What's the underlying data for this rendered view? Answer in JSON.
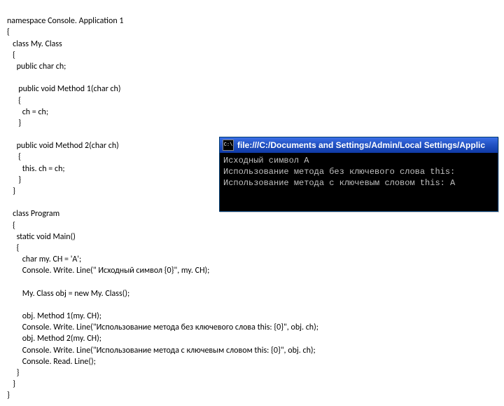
{
  "code": {
    "l01": "namespace Console. Application 1",
    "l02": "{",
    "l03": "   class My. Class",
    "l04": "   {",
    "l05": "     public char ch;",
    "l06": "",
    "l07": "      public void Method 1(char ch)",
    "l08": "      {",
    "l09": "        ch = ch;",
    "l10": "      }",
    "l11": "",
    "l12": "     public void Method 2(char ch)",
    "l13": "      {",
    "l14": "        this. ch = ch;",
    "l15": "      }",
    "l16": "   }",
    "l17": "",
    "l18": "   class Program",
    "l19": "   {",
    "l20": "     static void Main()",
    "l21": "     {",
    "l22": "        char my. CH = 'A';",
    "l23": "        Console. Write. Line(\" Исходный символ {0}\", my. CH);",
    "l24": "",
    "l25": "        My. Class obj = new My. Class();",
    "l26": "",
    "l27": "        obj. Method 1(my. CH);",
    "l28": "        Console. Write. Line(\"Использование метода без ключевого слова this: {0}\", obj. ch);",
    "l29": "        obj. Method 2(my. CH);",
    "l30": "        Console. Write. Line(\"Использование метода с ключевым словом this: {0}\", obj. ch);",
    "l31": "        Console. Read. Line();",
    "l32": "     }",
    "l33": "   }",
    "l34": "}"
  },
  "console": {
    "icon_text": "C:\\",
    "title": "file:///C:/Documents and Settings/Admin/Local Settings/Applic",
    "line1": "Исходный символ A",
    "line2": "Использование метода без ключевого слова this:",
    "line3": "Использование метода с ключевым словом this: A"
  }
}
